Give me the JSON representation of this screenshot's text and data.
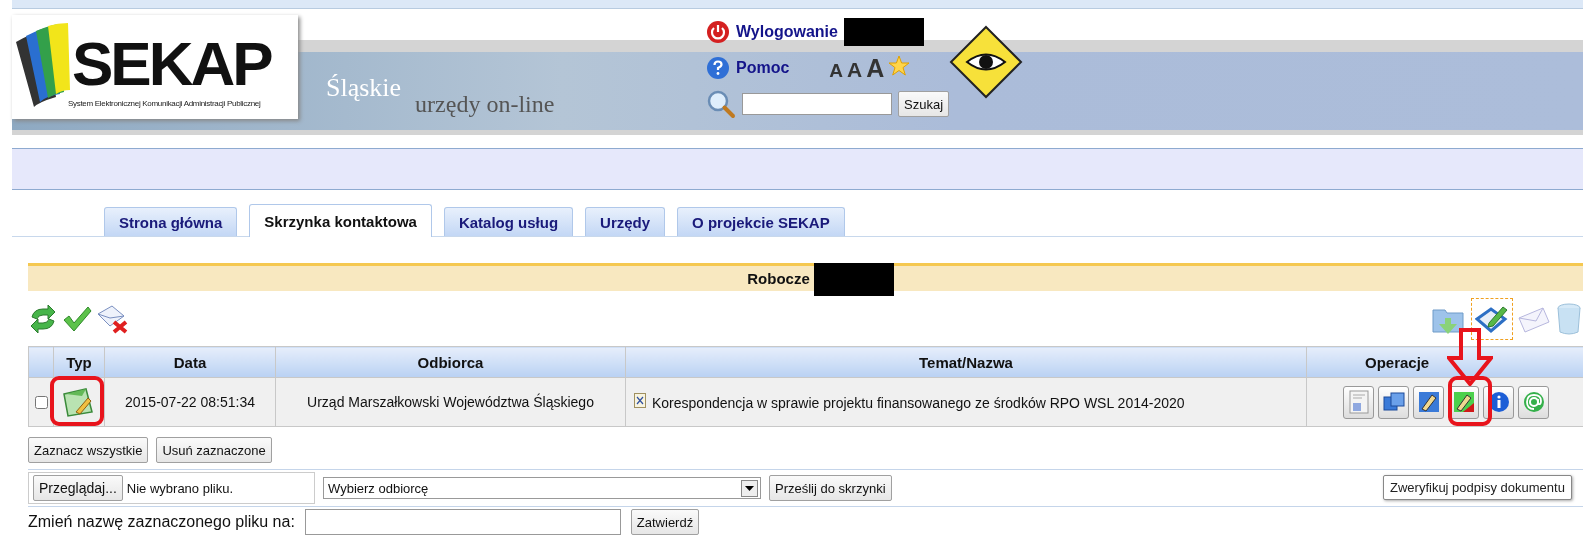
{
  "header": {
    "logo_title": "SEKAP",
    "logo_subtitle": "System Elektronicznej Komunikacji Administracji Publicznej",
    "region": "Śląskie",
    "tagline": "urzędy on-line",
    "logout": "Wylogowanie",
    "help": "Pomoc",
    "font_sizes": [
      "A",
      "A",
      "A"
    ],
    "search": {
      "button": "Szukaj"
    }
  },
  "tabs": [
    {
      "label": "Strona główna",
      "selected": false
    },
    {
      "label": "Skrzynka kontaktowa",
      "selected": true
    },
    {
      "label": "Katalog usług",
      "selected": false
    },
    {
      "label": "Urzędy",
      "selected": false
    },
    {
      "label": "O projekcie SEKAP",
      "selected": false
    }
  ],
  "section": {
    "title": "Robocze"
  },
  "table": {
    "columns": [
      "Typ",
      "Data",
      "Odbiorca",
      "Temat/Nazwa",
      "Operacje"
    ],
    "rows": [
      {
        "checked": false,
        "date": "2015-07-22 08:51:34",
        "recipient": "Urząd Marszałkowski Województwa Śląskiego",
        "subject": "Korespondencja w sprawie projektu finansowanego ze środków RPO WSL 2014-2020"
      }
    ]
  },
  "selection_buttons": [
    "Zaznacz wszystkie",
    "Usuń zaznaczone"
  ],
  "upload": {
    "browse": "Przeglądaj...",
    "file_status": "Nie wybrano pliku.",
    "recipient_select": "Wybierz odbiorcę",
    "send": "Prześlij do skrzynki"
  },
  "rename": {
    "label": "Zmień nazwę zaznaczonego pliku na:",
    "confirm": "Zatwierdź"
  },
  "tooltip": "Zweryfikuj podpisy dokumentu"
}
